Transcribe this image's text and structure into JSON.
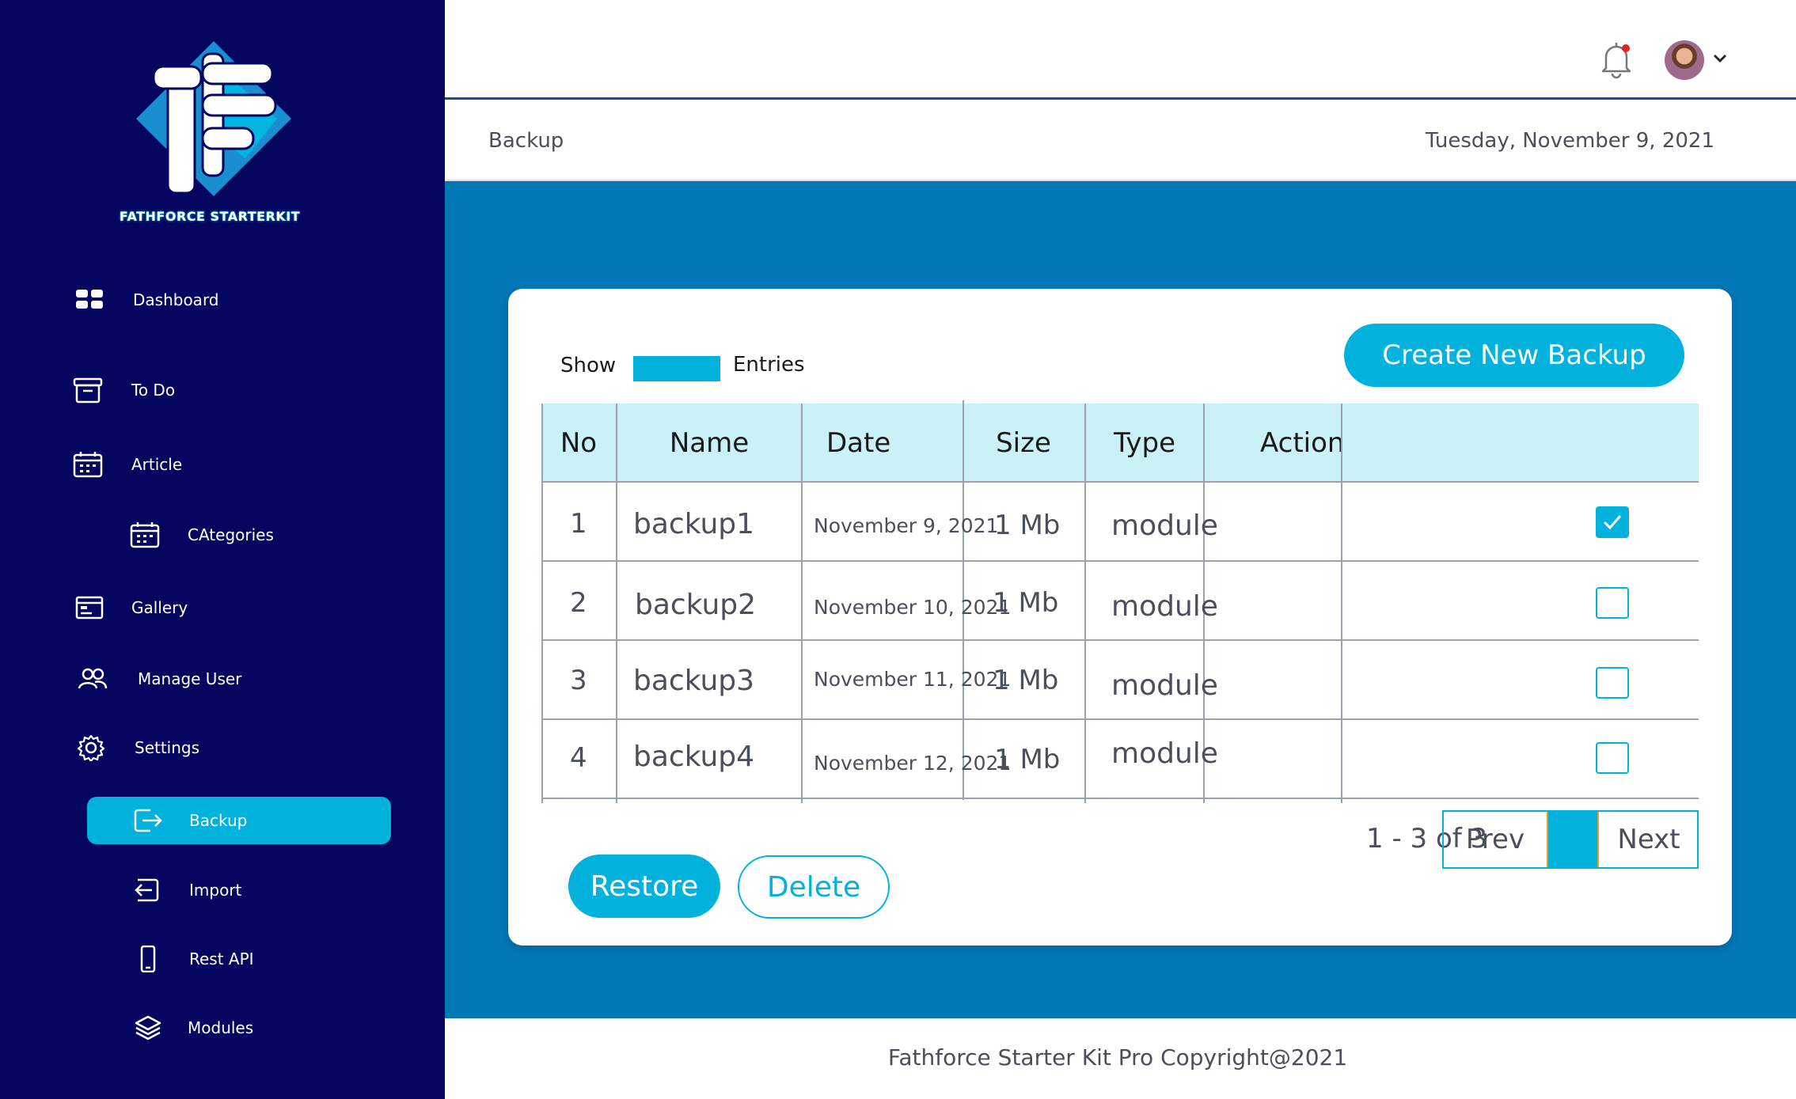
{
  "brand": {
    "name": "FATHFORCE STARTERKIT"
  },
  "colors": {
    "sidebar": "#05065f",
    "accent": "#00b2dc",
    "main_bg": "#0277b6",
    "header_row": "#caf0f8"
  },
  "sidebar": {
    "items": [
      {
        "label": "Dashboard",
        "icon": "dashboard-icon"
      },
      {
        "label": "To Do",
        "icon": "archive-icon"
      },
      {
        "label": "Article",
        "icon": "calendar-icon"
      },
      {
        "label": "CAtegories",
        "icon": "calendar-icon"
      },
      {
        "label": "Gallery",
        "icon": "browser-window-icon"
      },
      {
        "label": "Manage User",
        "icon": "users-icon"
      },
      {
        "label": "Settings",
        "icon": "gear-icon"
      },
      {
        "label": "Backup",
        "icon": "export-icon",
        "active": true
      },
      {
        "label": "Import",
        "icon": "import-icon"
      },
      {
        "label": "Rest API",
        "icon": "phone-icon"
      },
      {
        "label": "Modules",
        "icon": "layers-icon"
      }
    ]
  },
  "header": {
    "title": "Backup",
    "date": "Tuesday, November 9, 2021"
  },
  "toolbar": {
    "show_label": "Show",
    "entries_label": "Entries",
    "create_label": "Create New Backup"
  },
  "table": {
    "columns": [
      "No",
      "Name",
      "Date",
      "Size",
      "Type",
      "Action"
    ],
    "rows": [
      {
        "no": "1",
        "name": "backup1",
        "date": "November 9, 2021",
        "size": "1 Mb",
        "type": "module",
        "checked": true
      },
      {
        "no": "2",
        "name": "backup2",
        "date": "November 10, 2021",
        "size": "1 Mb",
        "type": "module",
        "checked": false
      },
      {
        "no": "3",
        "name": "backup3",
        "date": "November 11, 2021",
        "size": "1 Mb",
        "type": "module",
        "checked": false
      },
      {
        "no": "4",
        "name": "backup4",
        "date": "November 12, 2021",
        "size": "1 Mb",
        "type": "module",
        "checked": false
      }
    ]
  },
  "pagination": {
    "info": "1 - 3 of 3",
    "prev_label": "Prev",
    "next_label": "Next"
  },
  "actions": {
    "restore_label": "Restore",
    "delete_label": "Delete"
  },
  "footer": {
    "text": "Fathforce Starter Kit Pro Copyright@2021"
  }
}
